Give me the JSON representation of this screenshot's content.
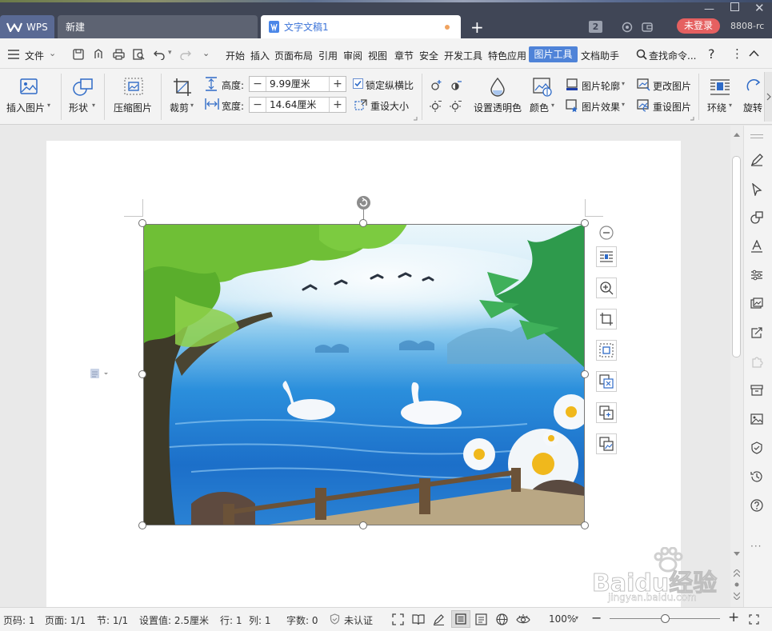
{
  "titlebar": {
    "tabs": [
      {
        "label": "WPS"
      },
      {
        "label": "新建"
      },
      {
        "label": "文字文稿1"
      }
    ],
    "window_count": "2",
    "login_label": "未登录",
    "version": "8808-rc"
  },
  "menubar": {
    "file_label": "文件",
    "items": [
      "开始",
      "插入",
      "页面布局",
      "引用",
      "审阅",
      "视图",
      "章节",
      "安全",
      "开发工具",
      "特色应用",
      "图片工具",
      "文档助手"
    ],
    "active_item": "图片工具",
    "search_label": "查找命令..."
  },
  "ribbon": {
    "insert_picture": "插入图片",
    "shape": "形状",
    "compress": "压缩图片",
    "crop": "裁剪",
    "height_label": "高度:",
    "height_value": "9.99厘米",
    "width_label": "宽度:",
    "width_value": "14.64厘米",
    "lock_ratio": "锁定纵横比",
    "lock_ratio_checked": true,
    "reset_size": "重设大小",
    "transparency": "设置透明色",
    "color": "颜色",
    "outline": "图片轮廓",
    "effects": "图片效果",
    "change_picture": "更改图片",
    "reset_picture": "重设图片",
    "wrap": "环绕",
    "rotate": "旋转"
  },
  "statusbar": {
    "page_num": "页码: 1",
    "page_count": "页面: 1/1",
    "section": "节: 1/1",
    "setting": "设置值: 2.5厘米",
    "row": "行: 1",
    "col": "列: 1",
    "word_count": "字数: 0",
    "auth": "未认证",
    "zoom": "100%",
    "zoom_level": 0.5
  },
  "watermark": {
    "brand": "Baidu经验",
    "url": "jingyan.baidu.com"
  },
  "colors": {
    "titlebar": "#404656",
    "accent": "#4f83d8",
    "login": "#e56060"
  }
}
